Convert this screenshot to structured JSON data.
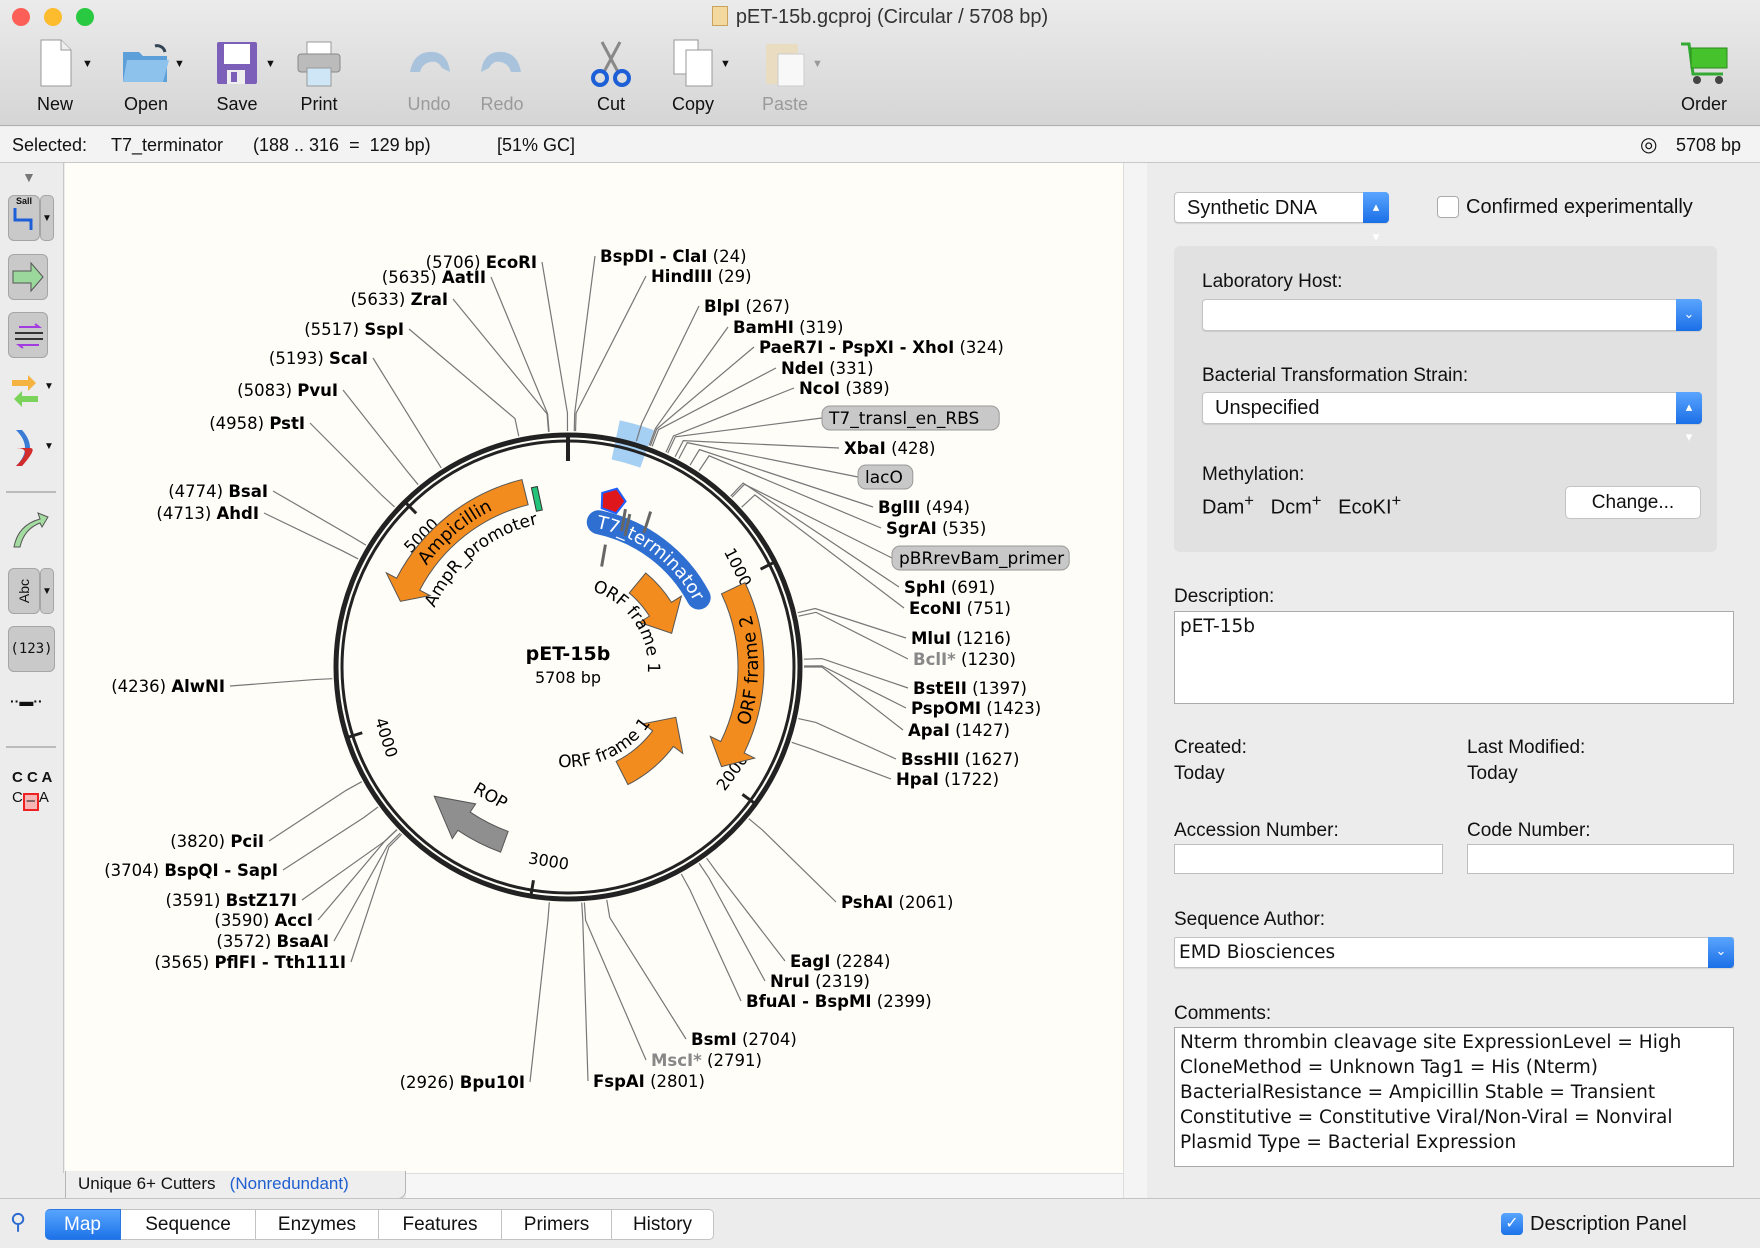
{
  "window": {
    "title": "pET-15b.gcproj  (Circular / 5708 bp)"
  },
  "toolbar": {
    "new": "New",
    "open": "Open",
    "save": "Save",
    "print": "Print",
    "undo": "Undo",
    "redo": "Redo",
    "cut": "Cut",
    "copy": "Copy",
    "paste": "Paste",
    "order": "Order"
  },
  "status": {
    "selected_label": "Selected:",
    "feature": "T7_terminator",
    "range": "(188 .. 316  =  129 bp)",
    "gc": "[51% GC]",
    "length": "5708 bp",
    "sel_start": 188,
    "sel_end": 316
  },
  "left_tools": {
    "enzyme_tool_label": "SalI",
    "text_tool_label": "Abc",
    "number_tool_label": "(123)",
    "seq_top": "C C A",
    "seq_bottom_left": "C",
    "seq_bottom_right": "A"
  },
  "map": {
    "name": "pET-15b",
    "length_label": "5708 bp",
    "total_bp": 5708,
    "ticks": [
      "1000",
      "2000",
      "3000",
      "4000",
      "5000"
    ],
    "colors": {
      "orf": "#f28c1e",
      "terminator": "#2f6fd1",
      "rop": "#8f8f8f",
      "selection": "#9ccbf2",
      "promoter": "#22c47a",
      "origin_marker": "#e0161d"
    },
    "features": {
      "ampicillin": "Ampicillin",
      "ampr_promoter": "AmpR_promoter",
      "orf1a": "ORF frame 1",
      "orf1b": "ORF frame 1",
      "orf2": "ORF frame 2",
      "rop": "ROP",
      "t7_terminator": "T7_terminator"
    },
    "feature_tags": [
      "T7_transl_en_RBS",
      "lacO",
      "pBRrevBam_primer"
    ],
    "enzymes": [
      {
        "name": "EcoRI",
        "pos": 5706,
        "side": "left"
      },
      {
        "name": "AatII",
        "pos": 5635,
        "side": "left"
      },
      {
        "name": "ZraI",
        "pos": 5633,
        "side": "left"
      },
      {
        "name": "SspI",
        "pos": 5517,
        "side": "left"
      },
      {
        "name": "ScaI",
        "pos": 5193,
        "side": "left"
      },
      {
        "name": "PvuI",
        "pos": 5083,
        "side": "left"
      },
      {
        "name": "PstI",
        "pos": 4958,
        "side": "left"
      },
      {
        "name": "BsaI",
        "pos": 4774,
        "side": "left"
      },
      {
        "name": "AhdI",
        "pos": 4713,
        "side": "left"
      },
      {
        "name": "AlwNI",
        "pos": 4236,
        "side": "left"
      },
      {
        "name": "PciI",
        "pos": 3820,
        "side": "left"
      },
      {
        "name": "BspQI - SapI",
        "pos": 3704,
        "side": "left"
      },
      {
        "name": "BstZ17I",
        "pos": 3591,
        "side": "left"
      },
      {
        "name": "AccI",
        "pos": 3590,
        "side": "left"
      },
      {
        "name": "BsaAI",
        "pos": 3572,
        "side": "left"
      },
      {
        "name": "PflFI - Tth111I",
        "pos": 3565,
        "side": "left"
      },
      {
        "name": "Bpu10I",
        "pos": 2926,
        "side": "left"
      },
      {
        "name": "BspDI - ClaI",
        "pos": 24,
        "side": "right"
      },
      {
        "name": "HindIII",
        "pos": 29,
        "side": "right"
      },
      {
        "name": "BlpI",
        "pos": 267,
        "side": "right"
      },
      {
        "name": "BamHI",
        "pos": 319,
        "side": "right"
      },
      {
        "name": "PaeR7I - PspXI - XhoI",
        "pos": 324,
        "side": "right"
      },
      {
        "name": "NdeI",
        "pos": 331,
        "side": "right"
      },
      {
        "name": "NcoI",
        "pos": 389,
        "side": "right"
      },
      {
        "name": "XbaI",
        "pos": 428,
        "side": "right"
      },
      {
        "name": "BglII",
        "pos": 494,
        "side": "right"
      },
      {
        "name": "SgrAI",
        "pos": 535,
        "side": "right"
      },
      {
        "name": "SphI",
        "pos": 691,
        "side": "right"
      },
      {
        "name": "EcoNI",
        "pos": 751,
        "side": "right"
      },
      {
        "name": "MluI",
        "pos": 1216,
        "side": "right"
      },
      {
        "name": "BclI*",
        "pos": 1230,
        "side": "right",
        "blocked": true
      },
      {
        "name": "BstEII",
        "pos": 1397,
        "side": "right"
      },
      {
        "name": "PspOMI",
        "pos": 1423,
        "side": "right"
      },
      {
        "name": "ApaI",
        "pos": 1427,
        "side": "right"
      },
      {
        "name": "BssHII",
        "pos": 1627,
        "side": "right"
      },
      {
        "name": "HpaI",
        "pos": 1722,
        "side": "right"
      },
      {
        "name": "PshAI",
        "pos": 2061,
        "side": "right"
      },
      {
        "name": "EagI",
        "pos": 2284,
        "side": "right"
      },
      {
        "name": "NruI",
        "pos": 2319,
        "side": "right"
      },
      {
        "name": "BfuAI - BspMI",
        "pos": 2399,
        "side": "right"
      },
      {
        "name": "BsmI",
        "pos": 2704,
        "side": "right"
      },
      {
        "name": "MscI*",
        "pos": 2791,
        "side": "right",
        "blocked": true
      },
      {
        "name": "FspAI",
        "pos": 2801,
        "side": "right"
      }
    ],
    "enzyme_set": "Unique 6+ Cutters",
    "enzyme_set_mode": "(Nonredundant)"
  },
  "panel": {
    "molecule_type": "Synthetic DNA",
    "confirmed_label": "Confirmed experimentally",
    "confirmed": false,
    "lab_host_label": "Laboratory Host:",
    "lab_host_value": "",
    "strain_label": "Bacterial Transformation Strain:",
    "strain_value": "Unspecified",
    "methylation_label": "Methylation:",
    "methylation": [
      {
        "name": "Dam",
        "sup": "+"
      },
      {
        "name": "Dcm",
        "sup": "+"
      },
      {
        "name": "EcoKI",
        "sup": "+"
      }
    ],
    "change_button": "Change...",
    "description_label": "Description:",
    "description_value": "pET-15b",
    "created_label": "Created:",
    "created_value": "Today",
    "modified_label": "Last Modified:",
    "modified_value": "Today",
    "accession_label": "Accession Number:",
    "accession_value": "",
    "code_label": "Code Number:",
    "code_value": "",
    "author_label": "Sequence Author:",
    "author_value": "EMD Biosciences",
    "comments_label": "Comments:",
    "comments_value": "Nterm thrombin cleavage site ExpressionLevel = High CloneMethod = Unknown Tag1 = His (Nterm) BacterialResistance = Ampicillin Stable = Transient Constitutive = Constitutive Viral/Non-Viral = Nonviral Plasmid Type = Bacterial Expression"
  },
  "tabs": [
    {
      "label": "Map",
      "active": true
    },
    {
      "label": "Sequence"
    },
    {
      "label": "Enzymes"
    },
    {
      "label": "Features"
    },
    {
      "label": "Primers"
    },
    {
      "label": "History"
    }
  ],
  "bottom": {
    "description_panel_label": "Description Panel",
    "description_panel_checked": true
  }
}
